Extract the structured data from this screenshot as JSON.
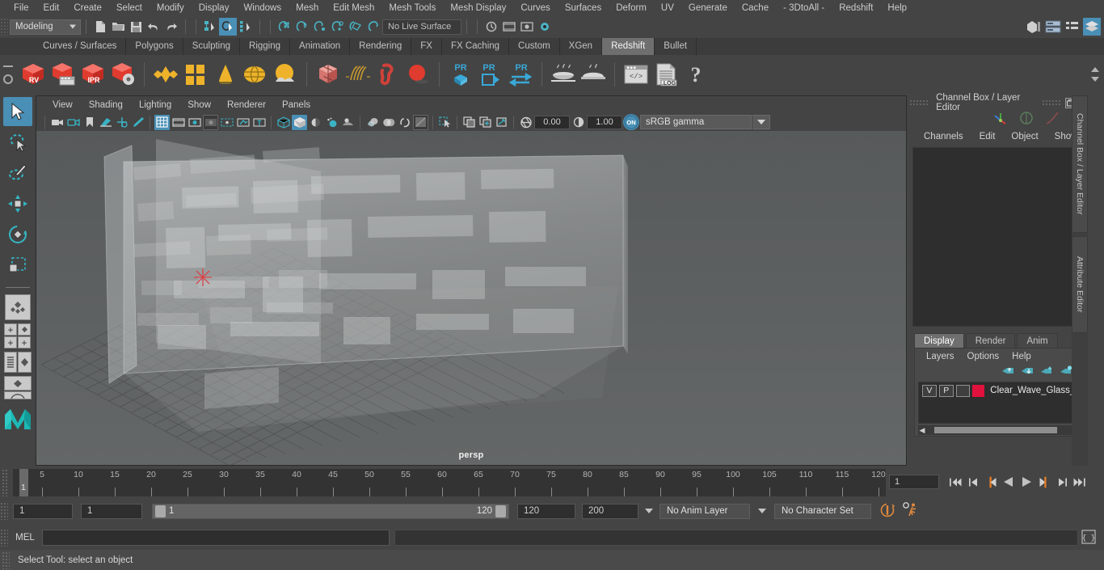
{
  "menubar": {
    "items": [
      "File",
      "Edit",
      "Create",
      "Select",
      "Modify",
      "Display",
      "Windows",
      "Mesh",
      "Edit Mesh",
      "Mesh Tools",
      "Mesh Display",
      "Curves",
      "Surfaces",
      "Deform",
      "UV",
      "Generate",
      "Cache",
      "- 3DtoAll -",
      "Redshift",
      "Help"
    ]
  },
  "statusline": {
    "mode_selector": "Modeling",
    "live_surface": "No Live Surface"
  },
  "shelf_tabs": {
    "tabs": [
      "Curves / Surfaces",
      "Polygons",
      "Sculpting",
      "Rigging",
      "Animation",
      "Rendering",
      "FX",
      "FX Caching",
      "Custom",
      "XGen",
      "Redshift",
      "Bullet"
    ],
    "active": "Redshift"
  },
  "shelf_icons": {
    "labels": [
      "RV",
      "IPR",
      ".LOG",
      "PR"
    ]
  },
  "viewport": {
    "menus": [
      "View",
      "Shading",
      "Lighting",
      "Show",
      "Renderer",
      "Panels"
    ],
    "exposure": "0.00",
    "gamma": "1.00",
    "color_space": "sRGB gamma",
    "camera_label": "persp"
  },
  "right_panel": {
    "title": "Channel Box / Layer Editor",
    "menus": [
      "Channels",
      "Edit",
      "Object",
      "Show"
    ],
    "layer_tabs": [
      "Display",
      "Render",
      "Anim"
    ],
    "active_layer_tab": "Display",
    "layer_menus": [
      "Layers",
      "Options",
      "Help"
    ],
    "layer_row": {
      "visibility": "V",
      "playback": "P",
      "color": "#e0113c",
      "name": "Clear_Wave_Glass_Blo"
    },
    "side_tabs": [
      "Channel Box / Layer Editor",
      "Attribute Editor"
    ]
  },
  "timeline": {
    "ticks": [
      5,
      10,
      15,
      20,
      25,
      30,
      35,
      40,
      45,
      50,
      55,
      60,
      65,
      70,
      75,
      80,
      85,
      90,
      95,
      100,
      105,
      110,
      115,
      120
    ],
    "current_frame": "1",
    "current_frame_field": "1",
    "range_start_field": "1",
    "anim_start_field": "1",
    "range_bar_start": "1",
    "range_bar_end": "120",
    "anim_end_field": "120",
    "playback_end_field": "200",
    "anim_layer": "No Anim Layer",
    "character_set": "No Character Set"
  },
  "command_line": {
    "language": "MEL",
    "input_value": "",
    "output_value": ""
  },
  "statusbar": {
    "message": "Select Tool: select an object"
  },
  "colors": {
    "accent_blue": "#4a8fb5",
    "panel_bg": "#444444",
    "dark_bg": "#2e2e2e",
    "redshift_red": "#d32f2f",
    "shelf_gold": "#e8b224",
    "orange": "#e07b28"
  }
}
